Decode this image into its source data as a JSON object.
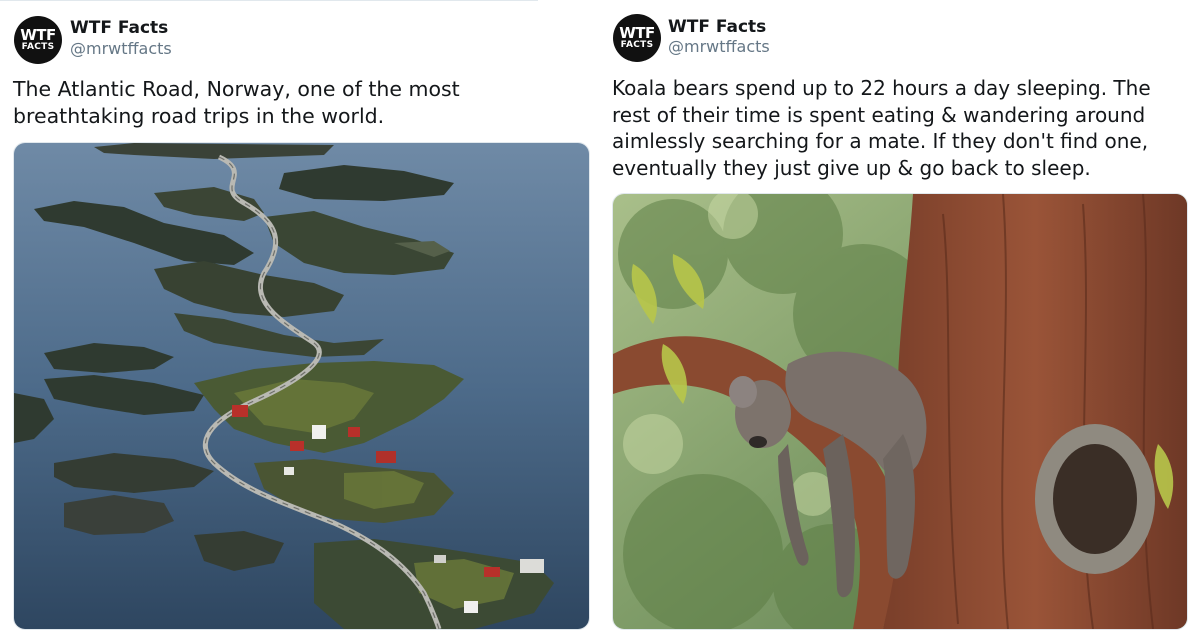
{
  "tweets": [
    {
      "avatar": {
        "line1": "WTF",
        "line2": "FACTS"
      },
      "name": "WTF Facts",
      "handle": "@mrwtffacts",
      "text_lines": [
        "The Atlantic Road, Norway, one of the most",
        "breathtaking road trips in the world."
      ]
    },
    {
      "avatar": {
        "line1": "WTF",
        "line2": "FACTS"
      },
      "name": "WTF Facts",
      "handle": "@mrwtffacts",
      "text_lines": [
        "Koala bears spend up to 22 hours a day sleeping. The",
        "rest of their time is spent eating & wandering around",
        "aimlessly searching for a mate. If they don't find one,",
        "eventually they just give up & go back to sleep."
      ]
    }
  ],
  "colors": {
    "name": "#14171a",
    "handle": "#657786",
    "border": "#e1e8ed",
    "sea": "#4a6a88"
  }
}
